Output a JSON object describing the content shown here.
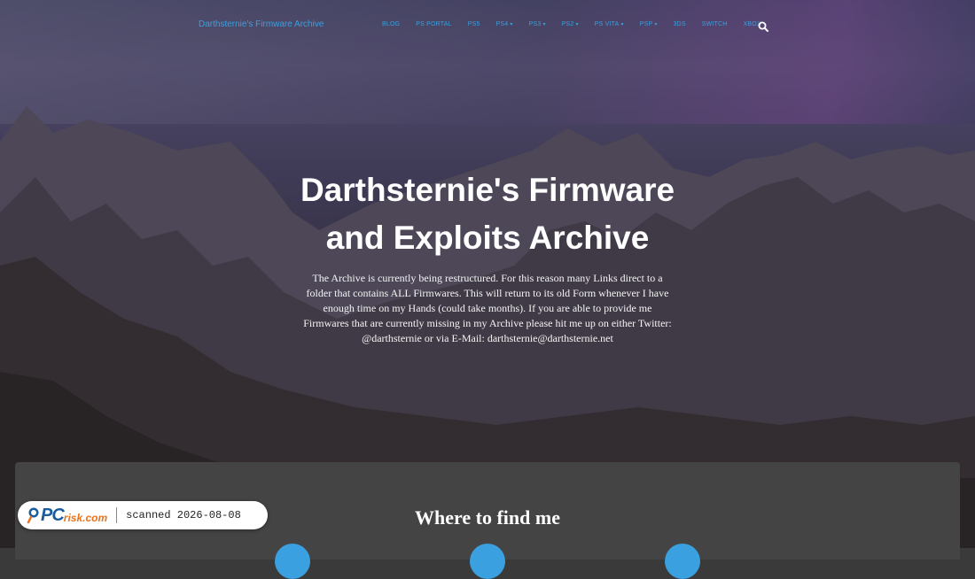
{
  "brand": "Darthsternie's Firmware Archive",
  "nav": {
    "items": [
      {
        "label": "BLOG",
        "dropdown": false
      },
      {
        "label": "PS PORTAL",
        "dropdown": false
      },
      {
        "label": "PS5",
        "dropdown": false
      },
      {
        "label": "PS4",
        "dropdown": true
      },
      {
        "label": "PS3",
        "dropdown": true
      },
      {
        "label": "PS2",
        "dropdown": true
      },
      {
        "label": "PS VITA",
        "dropdown": true
      },
      {
        "label": "PSP",
        "dropdown": true
      },
      {
        "label": "3DS",
        "dropdown": false
      },
      {
        "label": "SWITCH",
        "dropdown": false
      },
      {
        "label": "XBOX",
        "dropdown": false
      }
    ],
    "search_icon": "search-icon",
    "caret_glyph": "▾"
  },
  "hero": {
    "title_line1": "Darthsternie's Firmware",
    "title_line2": "and Exploits Archive",
    "text": "The Archive is currently being restructured. For this reason many Links direct to a folder that contains ALL Firmwares. This will return to its old Form whenever I have enough time on my Hands (could take months). If you are able to provide me Firmwares that are currently missing in my Archive please hit me up on either Twitter: @darthsternie or via E-Mail: darthsternie@darthsternie.net"
  },
  "section": {
    "title": "Where to find me"
  },
  "badge": {
    "logo_pc": "PC",
    "logo_risk": "risk.com",
    "text": "scanned 2026-08-08"
  },
  "colors": {
    "link": "#3aa0e0",
    "card": "#444444",
    "badge_blue": "#1b5a9c",
    "badge_orange": "#e8731c"
  }
}
